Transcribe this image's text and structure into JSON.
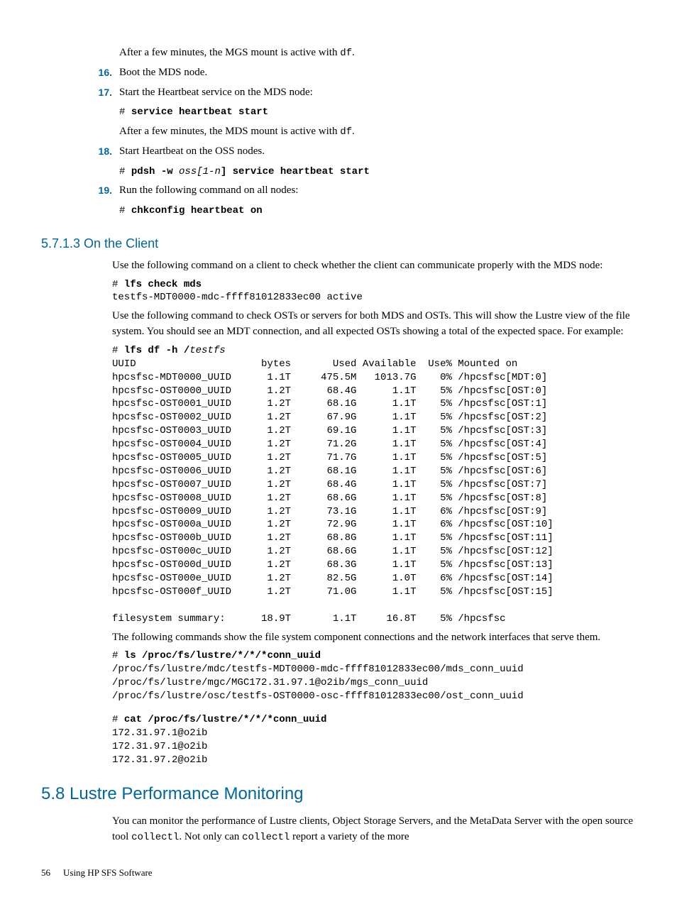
{
  "para1_a": "After a few minutes, the MGS mount is active with ",
  "para1_code": "df",
  "para1_b": ".",
  "step16": {
    "num": "16.",
    "text": "Boot the MDS node."
  },
  "step17": {
    "num": "17.",
    "text": "Start the Heartbeat service on the MDS node:"
  },
  "cmd17": {
    "hash": "# ",
    "cmd": "service heartbeat start"
  },
  "para17_a": "After a few minutes, the MDS mount is active with ",
  "para17_code": "df",
  "para17_b": ".",
  "step18": {
    "num": "18.",
    "text": "Start Heartbeat on the OSS nodes."
  },
  "cmd18": {
    "hash": "# ",
    "a": "pdsh -w ",
    "b": "oss[1-n",
    "c": "] service heartbeat start"
  },
  "step19": {
    "num": "19.",
    "text": "Run the following command on all nodes:"
  },
  "cmd19": {
    "hash": "# ",
    "cmd": "chkconfig heartbeat on"
  },
  "h3_client": "5.7.1.3 On the Client",
  "para_client": "Use the following command on a client to check whether the client can communicate properly with the MDS node:",
  "cmd_lfs_check": {
    "hash": "# ",
    "cmd": "lfs check mds"
  },
  "out_lfs_check": "testfs-MDT0000-mdc-ffff81012833ec00 active",
  "para_osts": "Use the following command to check OSTs or servers for both MDS and OSTs. This will show the Lustre view of the file system. You should see an MDT connection, and all expected OSTs showing a total of the expected space. For example:",
  "cmd_lfs_df": {
    "hash": "# ",
    "a": "lfs df -h /",
    "b": "testfs"
  },
  "lfs_df_output": "UUID                     bytes       Used Available  Use% Mounted on\nhpcsfsc-MDT0000_UUID      1.1T     475.5M   1013.7G    0% /hpcsfsc[MDT:0]\nhpcsfsc-OST0000_UUID      1.2T      68.4G      1.1T    5% /hpcsfsc[OST:0]\nhpcsfsc-OST0001_UUID      1.2T      68.1G      1.1T    5% /hpcsfsc[OST:1]\nhpcsfsc-OST0002_UUID      1.2T      67.9G      1.1T    5% /hpcsfsc[OST:2]\nhpcsfsc-OST0003_UUID      1.2T      69.1G      1.1T    5% /hpcsfsc[OST:3]\nhpcsfsc-OST0004_UUID      1.2T      71.2G      1.1T    5% /hpcsfsc[OST:4]\nhpcsfsc-OST0005_UUID      1.2T      71.7G      1.1T    5% /hpcsfsc[OST:5]\nhpcsfsc-OST0006_UUID      1.2T      68.1G      1.1T    5% /hpcsfsc[OST:6]\nhpcsfsc-OST0007_UUID      1.2T      68.4G      1.1T    5% /hpcsfsc[OST:7]\nhpcsfsc-OST0008_UUID      1.2T      68.6G      1.1T    5% /hpcsfsc[OST:8]\nhpcsfsc-OST0009_UUID      1.2T      73.1G      1.1T    6% /hpcsfsc[OST:9]\nhpcsfsc-OST000a_UUID      1.2T      72.9G      1.1T    6% /hpcsfsc[OST:10]\nhpcsfsc-OST000b_UUID      1.2T      68.8G      1.1T    5% /hpcsfsc[OST:11]\nhpcsfsc-OST000c_UUID      1.2T      68.6G      1.1T    5% /hpcsfsc[OST:12]\nhpcsfsc-OST000d_UUID      1.2T      68.3G      1.1T    5% /hpcsfsc[OST:13]\nhpcsfsc-OST000e_UUID      1.2T      82.5G      1.0T    6% /hpcsfsc[OST:14]\nhpcsfsc-OST000f_UUID      1.2T      71.0G      1.1T    5% /hpcsfsc[OST:15]\n\nfilesystem summary:      18.9T       1.1T     16.8T    5% /hpcsfsc",
  "para_fs_conn": "The following commands show the file system component connections and the network interfaces that serve them.",
  "cmd_ls": {
    "hash": "# ",
    "cmd": "ls /proc/fs/lustre/*/*/*conn_uuid"
  },
  "out_ls": "/proc/fs/lustre/mdc/testfs-MDT0000-mdc-ffff81012833ec00/mds_conn_uuid\n/proc/fs/lustre/mgc/MGC172.31.97.1@o2ib/mgs_conn_uuid\n/proc/fs/lustre/osc/testfs-OST0000-osc-ffff81012833ec00/ost_conn_uuid",
  "cmd_cat": {
    "hash": "# ",
    "cmd": "cat /proc/fs/lustre/*/*/*conn_uuid"
  },
  "out_cat": "172.31.97.1@o2ib\n172.31.97.1@o2ib\n172.31.97.2@o2ib",
  "h2_lustre": "5.8 Lustre Performance Monitoring",
  "para_monitor_a": "You can monitor the performance of Lustre clients, Object Storage Servers, and the MetaData Server with the open source tool ",
  "para_monitor_code1": "collectl",
  "para_monitor_b": ". Not only can ",
  "para_monitor_code2": "collectl",
  "para_monitor_c": " report a variety of the more",
  "footer": {
    "page": "56",
    "title": "Using HP SFS Software"
  }
}
